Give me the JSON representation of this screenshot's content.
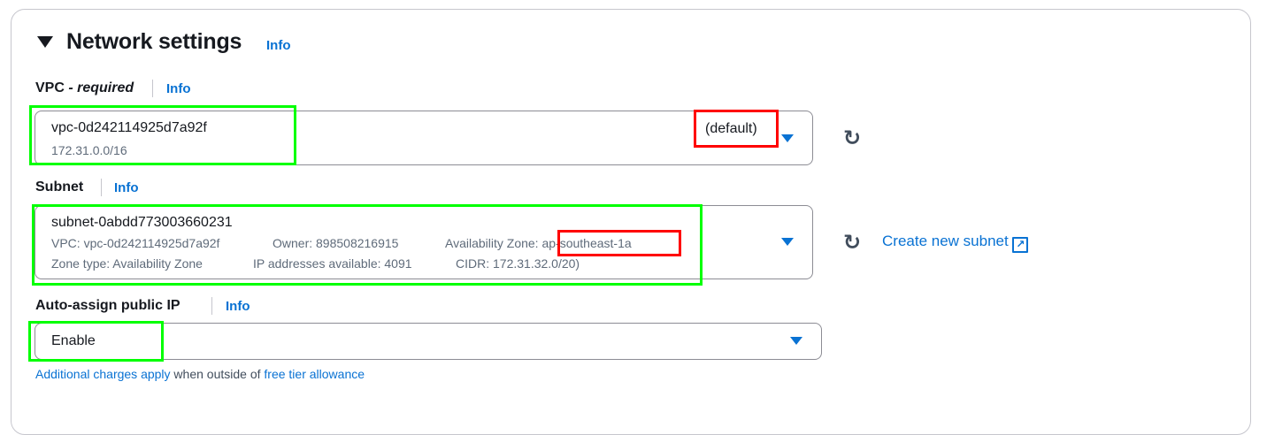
{
  "section": {
    "title": "Network settings",
    "info": "Info"
  },
  "vpc": {
    "label": "VPC",
    "required": "- required",
    "info": "Info",
    "value": "vpc-0d242114925d7a92f",
    "cidr": "172.31.0.0/16",
    "tag": "(default)"
  },
  "subnet": {
    "label": "Subnet",
    "info": "Info",
    "value": "subnet-0abdd773003660231",
    "vpc": "VPC: vpc-0d242114925d7a92f",
    "owner": "Owner: 898508216915",
    "az_label": "Availability Zone:",
    "az": "ap-southeast-1a",
    "zone_type": "Zone type: Availability Zone",
    "ips": "IP addresses available: 4091",
    "cidr": "CIDR: 172.31.32.0/20)",
    "create_link": "Create new subnet"
  },
  "public_ip": {
    "label": "Auto-assign public IP",
    "info": "Info",
    "value": "Enable",
    "note_link1": "Additional charges apply",
    "note_text": " when outside of ",
    "note_link2": "free tier allowance"
  },
  "colors": {
    "link": "#0972d3",
    "annotation_green": "#00ff00",
    "annotation_red": "#ff0000"
  }
}
